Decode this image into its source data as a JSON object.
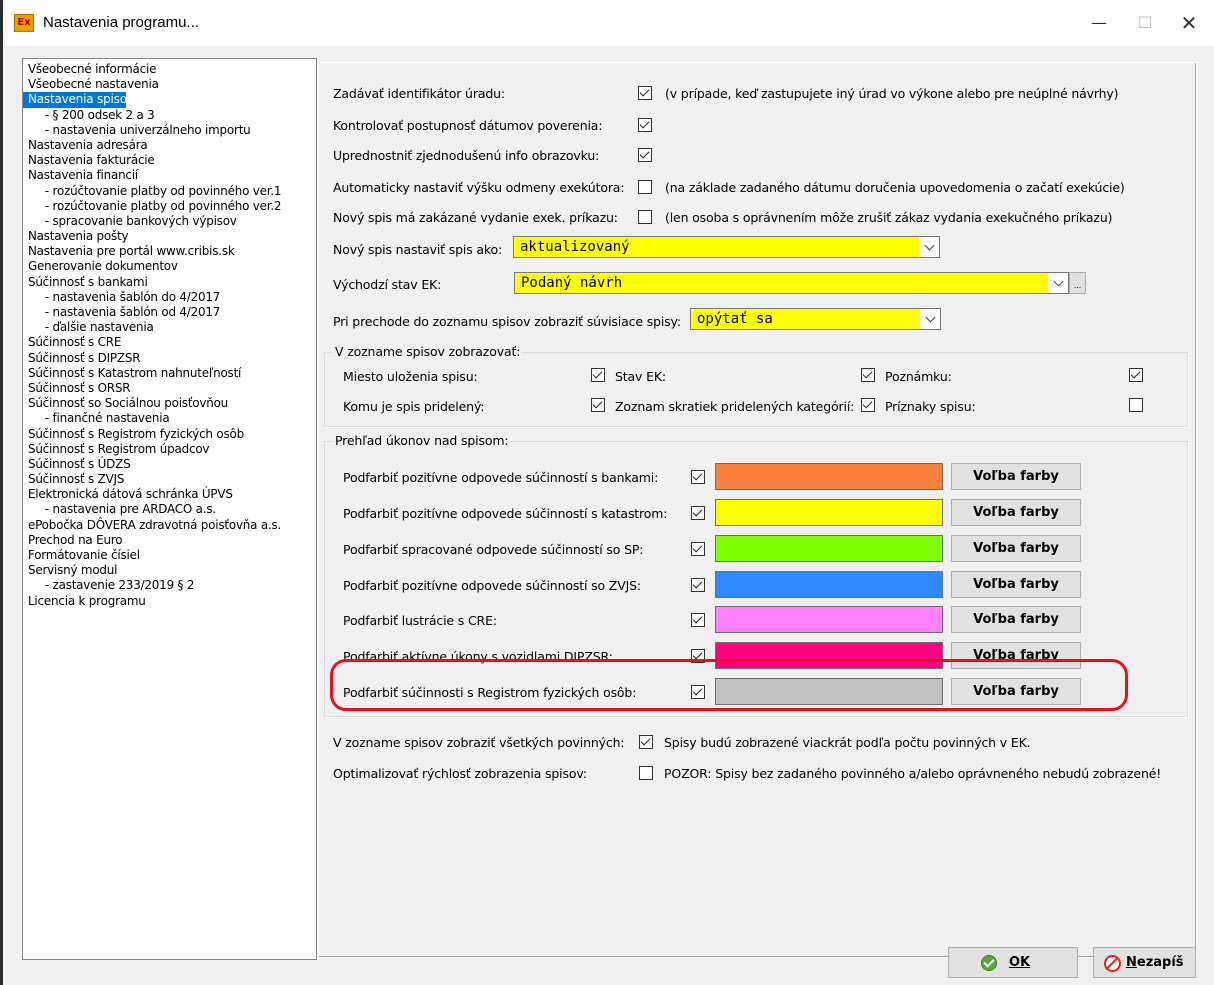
{
  "window": {
    "title": "Nastavenia programu...",
    "app_icon_text": "Ex",
    "minimize": "—",
    "maximize": "☐",
    "close": "✕"
  },
  "tree": {
    "items": [
      {
        "label": "Všeobecné informácie",
        "sub": false,
        "selected": false
      },
      {
        "label": "Všeobecné nastavenia",
        "sub": false,
        "selected": false
      },
      {
        "label": "Nastavenia spisov",
        "sub": false,
        "selected": true
      },
      {
        "label": "- § 200 odsek 2 a 3",
        "sub": true,
        "selected": false
      },
      {
        "label": "- nastavenia univerzálneho importu",
        "sub": true,
        "selected": false
      },
      {
        "label": "Nastavenia adresára",
        "sub": false,
        "selected": false
      },
      {
        "label": "Nastavenia fakturácie",
        "sub": false,
        "selected": false
      },
      {
        "label": "Nastavenia financií",
        "sub": false,
        "selected": false
      },
      {
        "label": "- rozúčtovanie platby od povinného ver.1",
        "sub": true,
        "selected": false
      },
      {
        "label": "- rozúčtovanie platby od povinného ver.2",
        "sub": true,
        "selected": false
      },
      {
        "label": "- spracovanie bankových výpisov",
        "sub": true,
        "selected": false
      },
      {
        "label": "Nastavenia pošty",
        "sub": false,
        "selected": false
      },
      {
        "label": "Nastavenia pre portál www.cribis.sk",
        "sub": false,
        "selected": false
      },
      {
        "label": "Generovanie dokumentov",
        "sub": false,
        "selected": false
      },
      {
        "label": "Súčinnosť s bankami",
        "sub": false,
        "selected": false
      },
      {
        "label": "- nastavenia šablón do 4/2017",
        "sub": true,
        "selected": false
      },
      {
        "label": "- nastavenia šablón od 4/2017",
        "sub": true,
        "selected": false
      },
      {
        "label": "- ďalšie nastavenia",
        "sub": true,
        "selected": false
      },
      {
        "label": "Súčinnosť s CRE",
        "sub": false,
        "selected": false
      },
      {
        "label": "Súčinnosť s DIPZSR",
        "sub": false,
        "selected": false
      },
      {
        "label": "Súčinnosť s Katastrom nahnuteľností",
        "sub": false,
        "selected": false
      },
      {
        "label": "Súčinnosť s ORSR",
        "sub": false,
        "selected": false
      },
      {
        "label": "Súčinnosť so Sociálnou poisťovňou",
        "sub": false,
        "selected": false
      },
      {
        "label": "- finančné nastavenia",
        "sub": true,
        "selected": false
      },
      {
        "label": "Súčinnosť s Registrom fyzických osôb",
        "sub": false,
        "selected": false
      },
      {
        "label": "Súčinnosť s Registrom úpadcov",
        "sub": false,
        "selected": false
      },
      {
        "label": "Súčinnosť s ÚDZS",
        "sub": false,
        "selected": false
      },
      {
        "label": "Súčinnosť s ZVJS",
        "sub": false,
        "selected": false
      },
      {
        "label": "Elektronická dátová schránka ÚPVS",
        "sub": false,
        "selected": false
      },
      {
        "label": "- nastavenia pre ARDACO a.s.",
        "sub": true,
        "selected": false
      },
      {
        "label": "ePobočka DÔVERA zdravotná poisťovňa a.s.",
        "sub": false,
        "selected": false
      },
      {
        "label": "Prechod na Euro",
        "sub": false,
        "selected": false
      },
      {
        "label": "Formátovanie čísiel",
        "sub": false,
        "selected": false
      },
      {
        "label": "Servisný modul",
        "sub": false,
        "selected": false
      },
      {
        "label": "- zastavenie 233/2019 § 2",
        "sub": true,
        "selected": false
      },
      {
        "label": "Licencia k programu",
        "sub": false,
        "selected": false
      }
    ]
  },
  "settings": {
    "office_id": {
      "label": "Zadávať identifikátor úradu:",
      "checked": true,
      "note": "(v prípade, keď zastupujete iný úrad vo výkone alebo pre neúplné návrhy)"
    },
    "date_order": {
      "label": "Kontrolovať postupnosť dátumov poverenia:",
      "checked": true
    },
    "simple_info": {
      "label": "Uprednostniť zjednodušenú info obrazovku:",
      "checked": true
    },
    "auto_fee": {
      "label": "Automaticky nastaviť výšku odmeny exekútora:",
      "checked": false,
      "note": "(na základe zadaného dátumu doručenia upovedomenia o začatí exekúcie)"
    },
    "ban_order": {
      "label": "Nový spis má zakázané vydanie exek. príkazu:",
      "checked": false,
      "note": "(len osoba s oprávnením môže zrušiť zákaz vydania exekučného príkazu)"
    },
    "new_file_as": {
      "label": "Nový spis nastaviť spis ako:",
      "value": "aktualizovaný"
    },
    "default_state": {
      "label": "Východzí stav EK:",
      "value": "Podaný návrh",
      "more": "..."
    },
    "related_files": {
      "label": "Pri prechode do zoznamu spisov zobraziť súvisiace spisy:",
      "value": "opýtať sa"
    }
  },
  "list_group": {
    "title": "V zozname spisov zobrazovať:",
    "row1": {
      "storage": "Miesto uloženia spisu:",
      "state": "Stav EK:",
      "note": "Poznámku:"
    },
    "row2": {
      "assigned": "Komu je spis pridelený:",
      "categories": "Zoznam skratiek pridelených kategórií:",
      "flags": "Príznaky spisu:"
    },
    "checks": {
      "storage": true,
      "state": true,
      "note": true,
      "assigned": true,
      "categories": true,
      "flags": false
    }
  },
  "overview_group": {
    "title": "Prehľad úkonov nad spisom:",
    "button_label": "Voľba farby",
    "rows": [
      {
        "label": "Podfarbiť pozitívne odpovede súčinností s bankami:",
        "checked": true,
        "color": "#f6803c"
      },
      {
        "label": "Podfarbiť pozitívne odpovede súčinností s katastrom:",
        "checked": true,
        "color": "#ffff00"
      },
      {
        "label": "Podfarbiť spracované odpovede súčinností so SP:",
        "checked": true,
        "color": "#80ff00"
      },
      {
        "label": "Podfarbiť pozitívne odpovede súčinností so ZVJS:",
        "checked": true,
        "color": "#2f8aff"
      },
      {
        "label": "Podfarbiť lustrácie s CRE:",
        "checked": true,
        "color": "#ff80ff"
      },
      {
        "label": "Podfarbiť aktívne úkony s vozidlami DIPZSR:",
        "checked": true,
        "color": "#ff0080"
      },
      {
        "label": "Podfarbiť súčinnosti s Registrom fyzických osôb:",
        "checked": true,
        "color": "#c0c0c0"
      }
    ]
  },
  "bottom": {
    "all_debtors": {
      "label": "V zozname spisov zobraziť všetkých povinných:",
      "checked": true,
      "note": "Spisy budú zobrazené viackrát podľa počtu povinných v EK."
    },
    "optimize": {
      "label": "Optimalizovať rýchlosť zobrazenia spisov:",
      "checked": false,
      "note": "POZOR: Spisy bez zadaného povinného a/alebo oprávneného nebudú zobrazené!"
    }
  },
  "buttons": {
    "ok": "OK",
    "cancel": "Nezapíš"
  }
}
